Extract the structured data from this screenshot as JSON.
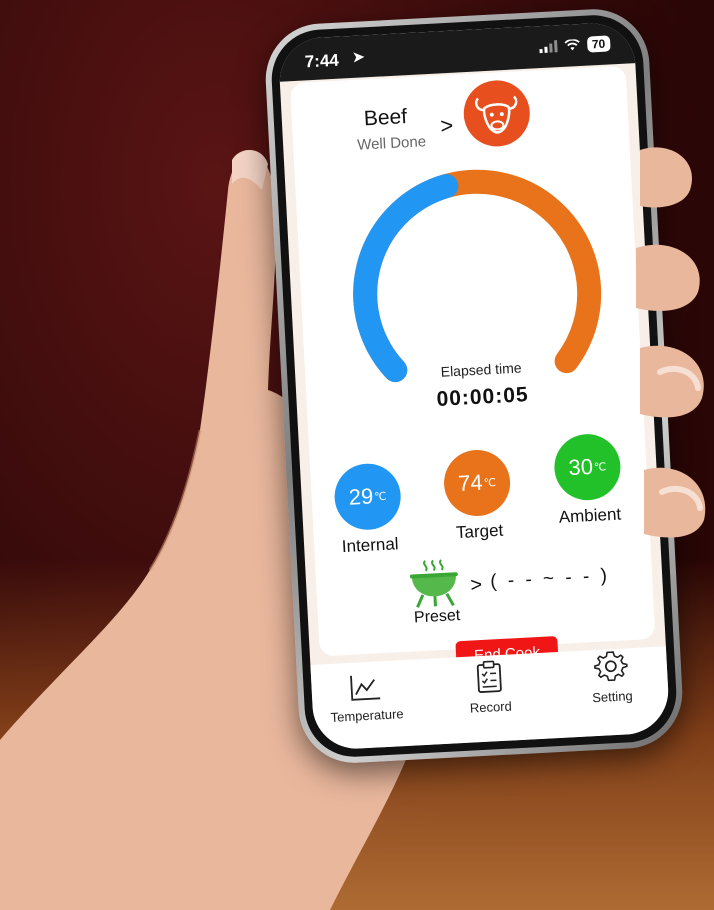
{
  "status_bar": {
    "time": "7:44",
    "battery": "70"
  },
  "meat": {
    "name": "Beef",
    "doneness": "Well Done",
    "arrow": ">",
    "icon": "cow-head-icon"
  },
  "timer": {
    "label": "Elapsed time",
    "value": "00:00:05",
    "progress": 0.45
  },
  "temperatures": [
    {
      "value": "29",
      "unit": "℃",
      "label": "Internal",
      "color": "#2196f3"
    },
    {
      "value": "74",
      "unit": "℃",
      "label": "Target",
      "color": "#e8731a"
    },
    {
      "value": "30",
      "unit": "℃",
      "label": "Ambient",
      "color": "#22c12a"
    }
  ],
  "preset": {
    "label": "Preset",
    "arrow": ">",
    "range": "( - - ~ - - )",
    "icon": "grill-icon"
  },
  "actions": {
    "end_cook": "End Cook"
  },
  "tabs": [
    {
      "label": "Temperature",
      "icon": "line-chart-icon"
    },
    {
      "label": "Record",
      "icon": "clipboard-icon"
    },
    {
      "label": "Setting",
      "icon": "gear-icon"
    }
  ],
  "colors": {
    "blue": "#2196f3",
    "orange": "#e8731a",
    "green": "#22c12a",
    "red": "#f01616"
  }
}
